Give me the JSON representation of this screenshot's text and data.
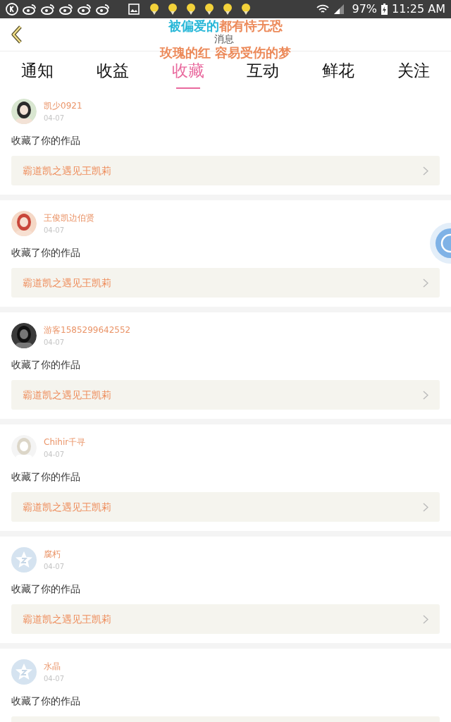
{
  "status_bar": {
    "battery": "97%",
    "time": "11:25 AM"
  },
  "header": {
    "title": "消息",
    "lyrics": [
      [
        {
          "text": "被偏爱的",
          "color": "#2ab8d8"
        },
        {
          "text": "都有恃无恐",
          "color": "#ec8a5a"
        }
      ],
      [
        {
          "text": "玫瑰的红 容易受伤的梦",
          "color": "#ec8a5a"
        }
      ]
    ]
  },
  "tabs": [
    {
      "label": "通知",
      "selected": false
    },
    {
      "label": "收益",
      "selected": false
    },
    {
      "label": "收藏",
      "selected": true
    },
    {
      "label": "互动",
      "selected": false
    },
    {
      "label": "鲜花",
      "selected": false
    },
    {
      "label": "关注",
      "selected": false
    }
  ],
  "items": [
    {
      "name": "凯少0921",
      "date": "04-07",
      "action": "收藏了你的作品",
      "link": "霸道凯之遇见王凯莉"
    },
    {
      "name": "王俊凯边伯贤",
      "date": "04-07",
      "action": "收藏了你的作品",
      "link": "霸道凯之遇见王凯莉"
    },
    {
      "name": "游客1585299642552",
      "date": "04-07",
      "action": "收藏了你的作品",
      "link": "霸道凯之遇见王凯莉"
    },
    {
      "name": "Chihir千寻",
      "date": "04-07",
      "action": "收藏了你的作品",
      "link": "霸道凯之遇见王凯莉"
    },
    {
      "avatar": {
        "kind": "default"
      },
      "name": "腐朽",
      "date": "04-07",
      "action": "收藏了你的作品",
      "link": "霸道凯之遇见王凯莉"
    },
    {
      "avatar": {
        "kind": "default"
      },
      "name": "水晶",
      "date": "04-07",
      "action": "收藏了你的作品"
    }
  ]
}
